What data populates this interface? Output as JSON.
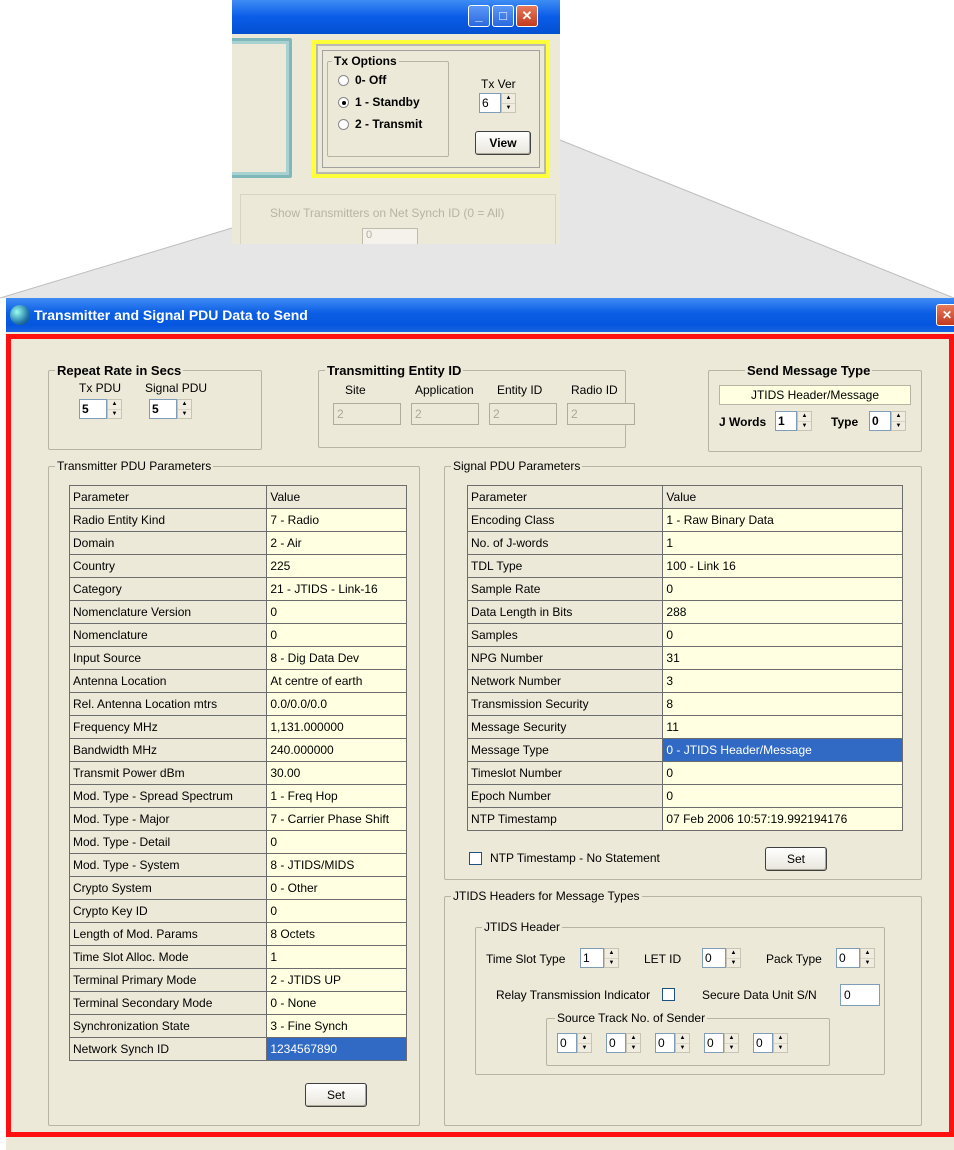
{
  "snippet": {
    "tx_options": {
      "title": "Tx Options",
      "options": [
        "0- Off",
        "1 - Standby",
        "2 - Transmit"
      ],
      "selected": 1,
      "tx_ver_label": "Tx Ver",
      "tx_ver_value": "6",
      "view_label": "View"
    },
    "show_transmitters_label": "Show Transmitters on Net Synch ID (0 = All)",
    "net_synch_value": "0"
  },
  "window": {
    "title": "Transmitter and Signal PDU Data to Send",
    "repeat": {
      "title": "Repeat Rate in Secs",
      "tx_pdu_label": "Tx PDU",
      "tx_pdu_value": "5",
      "signal_pdu_label": "Signal PDU",
      "signal_pdu_value": "5"
    },
    "entity": {
      "title": "Transmitting Entity ID",
      "site_label": "Site",
      "site_value": "2",
      "app_label": "Application",
      "app_value": "2",
      "entity_label": "Entity ID",
      "entity_value": "2",
      "radio_label": "Radio ID",
      "radio_value": "2"
    },
    "send": {
      "title": "Send Message Type",
      "value": "JTIDS Header/Message",
      "jwords_label": "J Words",
      "jwords_value": "1",
      "type_label": "Type",
      "type_value": "0"
    },
    "tx_params": {
      "title": "Transmitter PDU Parameters",
      "header": [
        "Parameter",
        "Value"
      ],
      "rows": [
        [
          "Radio Entity Kind",
          "7 - Radio"
        ],
        [
          "Domain",
          "2 - Air"
        ],
        [
          "Country",
          "225"
        ],
        [
          "Category",
          "21 - JTIDS - Link-16"
        ],
        [
          "Nomenclature Version",
          "0"
        ],
        [
          "Nomenclature",
          "0"
        ],
        [
          "Input Source",
          "8 - Dig Data Dev"
        ],
        [
          "Antenna Location",
          "At centre of earth"
        ],
        [
          "Rel. Antenna Location mtrs",
          "0.0/0.0/0.0"
        ],
        [
          "Frequency MHz",
          "1,131.000000"
        ],
        [
          "Bandwidth MHz",
          "240.000000"
        ],
        [
          "Transmit Power dBm",
          "30.00"
        ],
        [
          "Mod. Type - Spread Spectrum",
          "1 - Freq Hop"
        ],
        [
          "Mod. Type - Major",
          "7 - Carrier Phase Shift"
        ],
        [
          "Mod. Type - Detail",
          "0"
        ],
        [
          "Mod. Type - System",
          "8 - JTIDS/MIDS"
        ],
        [
          "Crypto System",
          "0 - Other"
        ],
        [
          "Crypto Key ID",
          "0"
        ],
        [
          "Length of Mod. Params",
          "8 Octets"
        ],
        [
          "Time Slot Alloc. Mode",
          "1"
        ],
        [
          "Terminal Primary Mode",
          "2 - JTIDS UP"
        ],
        [
          "Terminal Secondary Mode",
          "0 - None"
        ],
        [
          "Synchronization State",
          "3 - Fine Synch"
        ],
        [
          "Network Synch ID",
          "1234567890"
        ]
      ],
      "selected_row": 23,
      "set_label": "Set"
    },
    "sig_params": {
      "title": "Signal PDU Parameters",
      "header": [
        "Parameter",
        "Value"
      ],
      "rows": [
        [
          "Encoding Class",
          "1 - Raw Binary Data"
        ],
        [
          "No. of J-words",
          "1"
        ],
        [
          "TDL Type",
          "100 - Link 16"
        ],
        [
          "Sample Rate",
          "0"
        ],
        [
          "Data Length in Bits",
          "288"
        ],
        [
          "Samples",
          "0"
        ],
        [
          "NPG Number",
          "31"
        ],
        [
          "Network Number",
          "3"
        ],
        [
          "Transmission Security",
          "8"
        ],
        [
          "Message Security",
          "11"
        ],
        [
          "Message Type",
          "0 - JTIDS Header/Message"
        ],
        [
          "Timeslot Number",
          "0"
        ],
        [
          "Epoch Number",
          "0"
        ],
        [
          "NTP Timestamp",
          "07 Feb 2006    10:57:19.992194176"
        ]
      ],
      "selected_row": 10,
      "ntp_checkbox_label": "NTP Timestamp - No Statement",
      "set_label": "Set"
    },
    "jtids": {
      "title": "JTIDS Headers for Message Types",
      "header_group": "JTIDS Header",
      "slot_type_label": "Time Slot Type",
      "slot_type_value": "1",
      "let_id_label": "LET ID",
      "let_id_value": "0",
      "pack_type_label": "Pack Type",
      "pack_type_value": "0",
      "relay_label": "Relay Transmission Indicator",
      "secure_label": "Secure Data Unit S/N",
      "secure_value": "0",
      "source_track_label": "Source Track No. of Sender",
      "source_track_values": [
        "0",
        "0",
        "0",
        "0",
        "0"
      ]
    }
  }
}
